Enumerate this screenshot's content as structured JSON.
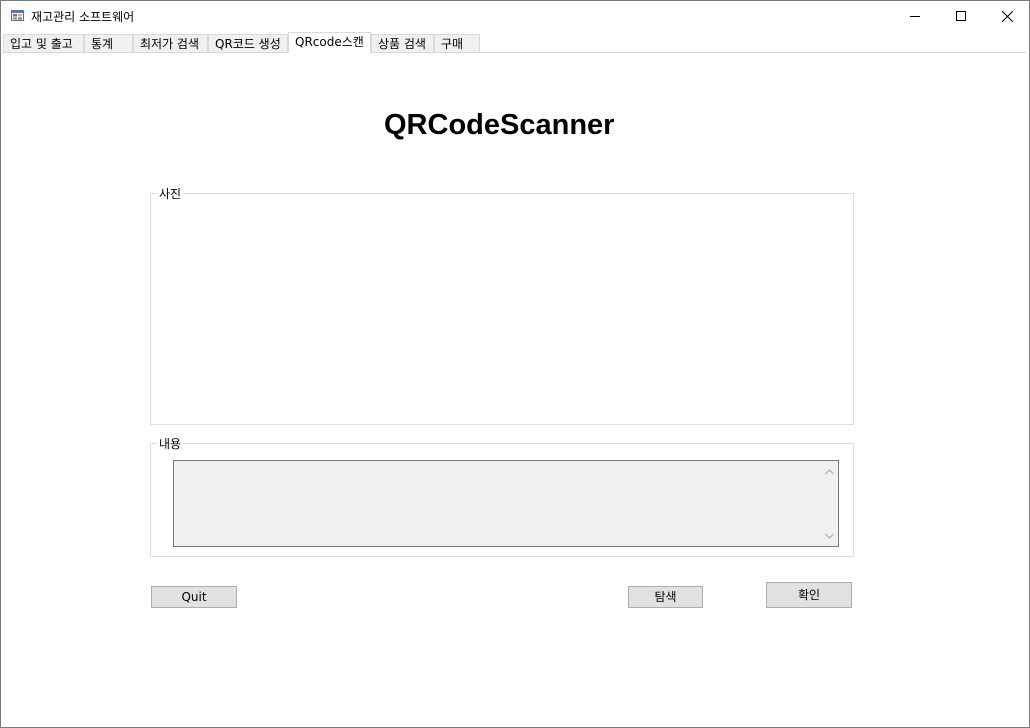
{
  "window": {
    "title": "재고관리 소프트웨어",
    "icon": "app-form-icon",
    "controls": {
      "minimize": "minimize-icon",
      "maximize": "maximize-icon",
      "close": "close-icon"
    }
  },
  "tabs": [
    {
      "label": "입고 및 출고",
      "active": false
    },
    {
      "label": "통계",
      "active": false
    },
    {
      "label": "최저가 검색",
      "active": false
    },
    {
      "label": "QR코드 생성",
      "active": false
    },
    {
      "label": "QRcode스캔",
      "active": true
    },
    {
      "label": "상품 검색",
      "active": false
    },
    {
      "label": "구매",
      "active": false
    }
  ],
  "page": {
    "heading": "QRCodeScanner",
    "photo_group_label": "사진",
    "content_group_label": "내용",
    "content_text": ""
  },
  "buttons": {
    "quit": "Quit",
    "search": "탐색",
    "confirm": "확인"
  }
}
